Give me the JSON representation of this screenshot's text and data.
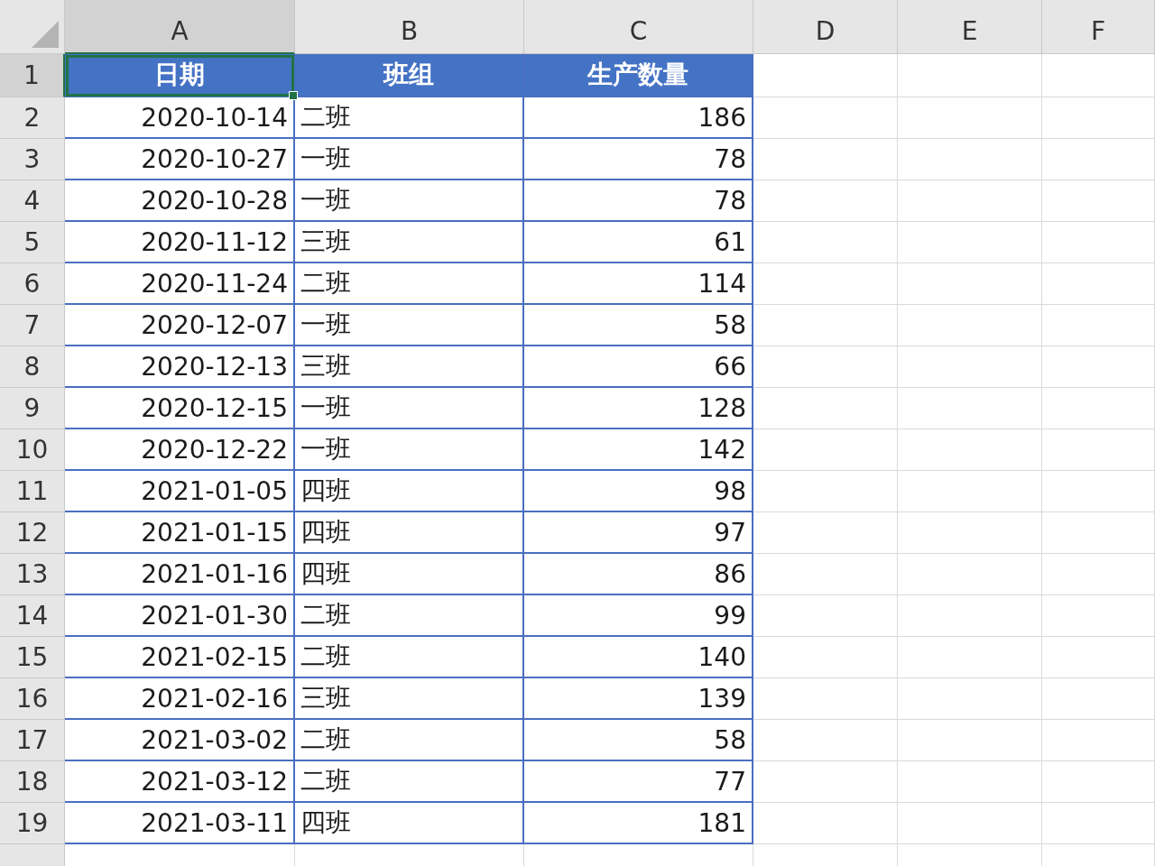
{
  "columns": [
    {
      "label": "A",
      "selected": true
    },
    {
      "label": "B",
      "selected": false
    },
    {
      "label": "C",
      "selected": false
    },
    {
      "label": "D",
      "selected": false
    },
    {
      "label": "E",
      "selected": false
    },
    {
      "label": "F",
      "selected": false
    }
  ],
  "rows": [
    {
      "number": "1",
      "selected": true,
      "kind": "header",
      "cells": [
        {
          "text": "日期",
          "selected": true
        },
        {
          "text": "班组",
          "selected": false
        },
        {
          "text": "生产数量",
          "selected": false
        }
      ]
    },
    {
      "number": "2",
      "selected": false,
      "kind": "data",
      "cells": [
        "2020-10-14",
        "二班",
        "186"
      ]
    },
    {
      "number": "3",
      "selected": false,
      "kind": "data",
      "cells": [
        "2020-10-27",
        "一班",
        "78"
      ]
    },
    {
      "number": "4",
      "selected": false,
      "kind": "data",
      "cells": [
        "2020-10-28",
        "一班",
        "78"
      ]
    },
    {
      "number": "5",
      "selected": false,
      "kind": "data",
      "cells": [
        "2020-11-12",
        "三班",
        "61"
      ]
    },
    {
      "number": "6",
      "selected": false,
      "kind": "data",
      "cells": [
        "2020-11-24",
        "二班",
        "114"
      ]
    },
    {
      "number": "7",
      "selected": false,
      "kind": "data",
      "cells": [
        "2020-12-07",
        "一班",
        "58"
      ]
    },
    {
      "number": "8",
      "selected": false,
      "kind": "data",
      "cells": [
        "2020-12-13",
        "三班",
        "66"
      ]
    },
    {
      "number": "9",
      "selected": false,
      "kind": "data",
      "cells": [
        "2020-12-15",
        "一班",
        "128"
      ]
    },
    {
      "number": "10",
      "selected": false,
      "kind": "data",
      "cells": [
        "2020-12-22",
        "一班",
        "142"
      ]
    },
    {
      "number": "11",
      "selected": false,
      "kind": "data",
      "cells": [
        "2021-01-05",
        "四班",
        "98"
      ]
    },
    {
      "number": "12",
      "selected": false,
      "kind": "data",
      "cells": [
        "2021-01-15",
        "四班",
        "97"
      ]
    },
    {
      "number": "13",
      "selected": false,
      "kind": "data",
      "cells": [
        "2021-01-16",
        "四班",
        "86"
      ]
    },
    {
      "number": "14",
      "selected": false,
      "kind": "data",
      "cells": [
        "2021-01-30",
        "二班",
        "99"
      ]
    },
    {
      "number": "15",
      "selected": false,
      "kind": "data",
      "cells": [
        "2021-02-15",
        "二班",
        "140"
      ]
    },
    {
      "number": "16",
      "selected": false,
      "kind": "data",
      "cells": [
        "2021-02-16",
        "三班",
        "139"
      ]
    },
    {
      "number": "17",
      "selected": false,
      "kind": "data",
      "cells": [
        "2021-03-02",
        "二班",
        "58"
      ]
    },
    {
      "number": "18",
      "selected": false,
      "kind": "data",
      "cells": [
        "2021-03-12",
        "二班",
        "77"
      ]
    },
    {
      "number": "19",
      "selected": false,
      "kind": "data",
      "cells": [
        "2021-03-11",
        "四班",
        "181"
      ]
    }
  ]
}
